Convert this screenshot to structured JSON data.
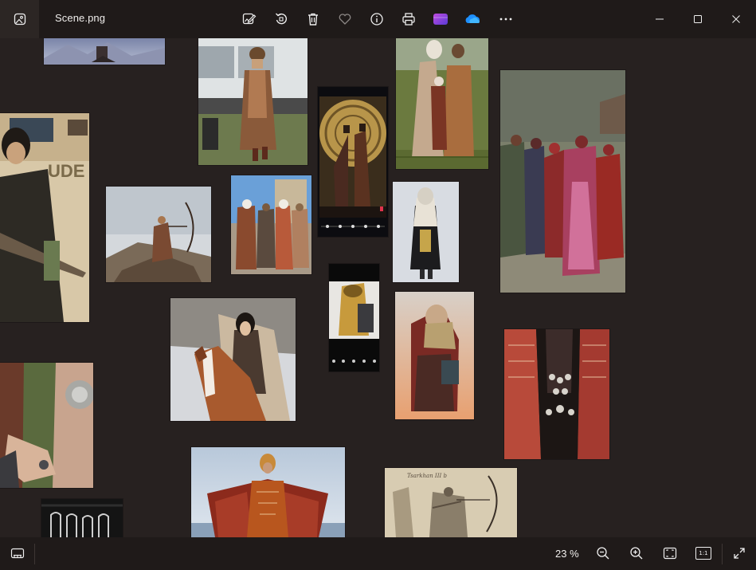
{
  "window": {
    "file_name": "Scene.png",
    "zoom_level": "23 %"
  },
  "toolbar": {
    "edit": "edit-icon",
    "rotate": "rotate-icon",
    "delete": "delete-icon",
    "favorite": "heart-icon",
    "info": "info-icon",
    "print": "print-icon",
    "clipchamp": "clipchamp-icon",
    "onedrive": "onedrive-icon",
    "more": "more-icon"
  },
  "window_controls": [
    "minimize-icon",
    "maximize-icon",
    "close-icon"
  ],
  "bottombar": {
    "filmstrip": "filmstrip-icon",
    "zoom_out": "zoom-out-icon",
    "zoom_in": "zoom-in-icon",
    "fit": "fit-to-window-icon",
    "actual_size": "1:1",
    "fullscreen": "fullscreen-icon"
  },
  "colors": {
    "canvas": "#272120",
    "titlebar": "#1f1a19",
    "clipchamp_purple": "#7b4ae0",
    "onedrive_blue": "#1e90ff"
  },
  "photos": [
    {
      "name": "photo-mountain-top"
    },
    {
      "name": "photo-woman-truck"
    },
    {
      "name": "photo-phone-pair"
    },
    {
      "name": "photo-family-field"
    },
    {
      "name": "photo-group-village"
    },
    {
      "name": "photo-warrior-left"
    },
    {
      "name": "photo-archer-rock"
    },
    {
      "name": "photo-three-costumes"
    },
    {
      "name": "photo-white-figure"
    },
    {
      "name": "photo-phone-mask"
    },
    {
      "name": "photo-horse-rider"
    },
    {
      "name": "photo-desert-rider"
    },
    {
      "name": "photo-jewelry-dress"
    },
    {
      "name": "photo-hands-jewelry"
    },
    {
      "name": "photo-robe-spread"
    },
    {
      "name": "photo-archer-sketch"
    },
    {
      "name": "photo-embroidery-bottom"
    }
  ],
  "sketch_caption": "Tsarkhan III b"
}
